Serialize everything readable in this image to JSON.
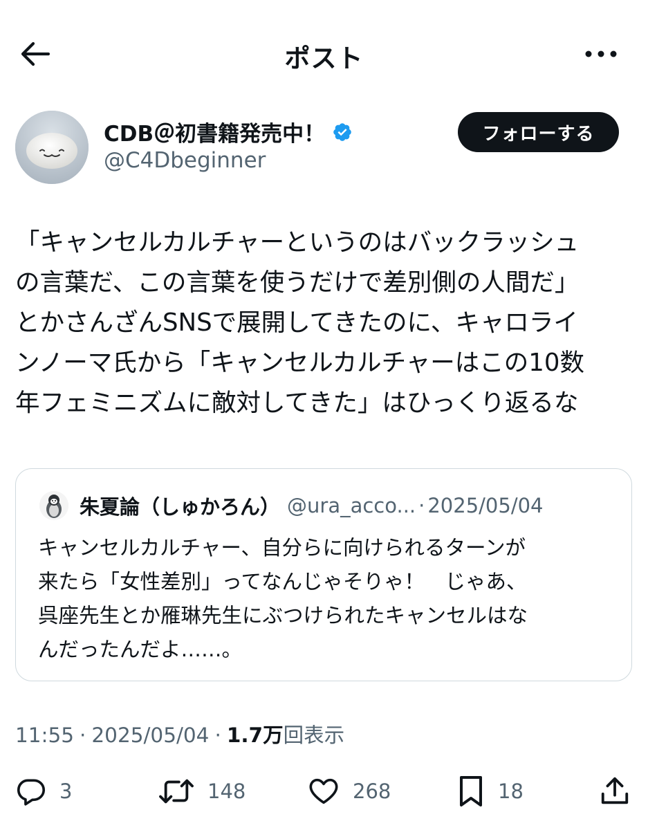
{
  "header": {
    "title": "ポスト"
  },
  "author": {
    "display_name": "CDB＠初書籍発売中！",
    "handle": "@C4Dbeginner",
    "verified": true,
    "follow_label": "フォローする"
  },
  "post": {
    "lines": [
      "「キャンセルカルチャーというのはバックラッシュ",
      "の言葉だ、この言葉を使うだけで差別側の人間だ」",
      "とかさんざんSNSで展開してきたのに、キャロライ",
      "ンノーマ氏から「キャンセルカルチャーはこの10数",
      "年フェミニズムに敵対してきた」はひっくり返るな"
    ]
  },
  "quote": {
    "name": "朱夏論（しゅかろん）",
    "handle": "@ura_acco...",
    "separator": "·",
    "date": "2025/05/04",
    "lines": [
      "キャンセルカルチャー、自分らに向けられるターンが",
      "来たら「女性差別」ってなんじゃそりゃ！　じゃあ、",
      "呉座先生とか雁琳先生にぶつけられたキャンセルはな",
      "んだったんだよ……。"
    ]
  },
  "meta": {
    "time": "11:55",
    "separator": "·",
    "date": "2025/05/04",
    "views_count": "1.7万",
    "views_label": "回表示"
  },
  "actions": {
    "replies": "3",
    "reposts": "148",
    "likes": "268",
    "bookmarks": "18"
  },
  "colors": {
    "text": "#0f1419",
    "secondary": "#536471",
    "border": "#cfd9de",
    "verified": "#1d9bf0"
  }
}
